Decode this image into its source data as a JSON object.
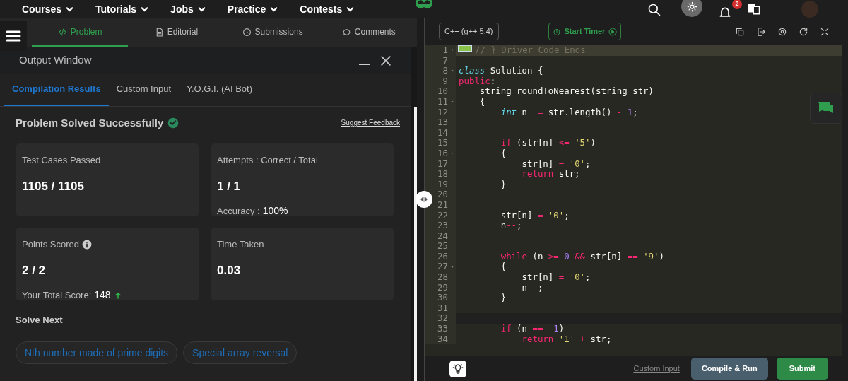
{
  "top_nav": {
    "items": [
      "Courses",
      "Tutorials",
      "Jobs",
      "Practice",
      "Contests"
    ],
    "notification_count": "2"
  },
  "problem_tabs": [
    {
      "label": "Problem",
      "selected": true
    },
    {
      "label": "Editorial",
      "selected": false
    },
    {
      "label": "Submissions",
      "selected": false
    },
    {
      "label": "Comments",
      "selected": false
    }
  ],
  "output_window": {
    "title": "Output Window",
    "tabs": [
      {
        "label": "Compilation Results",
        "selected": true
      },
      {
        "label": "Custom Input",
        "selected": false
      },
      {
        "label": "Y.O.G.I. (AI Bot)",
        "selected": false
      }
    ],
    "status": "Problem Solved Successfully",
    "feedback_link": "Suggest Feedback",
    "stats": [
      {
        "label": "Test Cases Passed",
        "value": "1105 / 1105",
        "info": false
      },
      {
        "label": "Attempts : Correct / Total",
        "value": "1 / 1",
        "info": false,
        "sub_label": "Accuracy :",
        "sub_value": "100%",
        "rising": false
      },
      {
        "label": "Points Scored",
        "value": "2 / 2",
        "info": true,
        "sub_label": "Your Total Score:",
        "sub_value": "148",
        "rising": true
      },
      {
        "label": "Time Taken",
        "value": "0.03",
        "info": false
      }
    ],
    "solve_next_title": "Solve Next",
    "solve_next": [
      "Nth number made of prime digits",
      "Special array reversal"
    ]
  },
  "editor": {
    "language": "C++ (g++ 5.4)",
    "timer_button": "Start Timer",
    "lines": [
      {
        "n": "1",
        "fold": true,
        "folded": true,
        "active": false,
        "tokens": [
          {
            "kind": "comment",
            "text": "// } Driver Code Ends"
          }
        ]
      },
      {
        "n": "7",
        "fold": false,
        "folded": false,
        "active": false
      },
      {
        "n": "8",
        "fold": true,
        "folded": false,
        "active": false,
        "tokens": [
          {
            "kind": "type",
            "text": "class"
          },
          {
            "kind": "plain",
            "text": " Solution {"
          }
        ]
      },
      {
        "n": "9",
        "fold": false,
        "folded": false,
        "active": false,
        "tokens": [
          {
            "kind": "keyword",
            "text": "public"
          },
          {
            "kind": "plain",
            "text": ":"
          }
        ]
      },
      {
        "n": "10",
        "fold": false,
        "folded": false,
        "active": false,
        "tokens": [
          {
            "kind": "plain",
            "text": "    string roundToNearest(string str)"
          }
        ]
      },
      {
        "n": "11",
        "fold": true,
        "folded": false,
        "active": false,
        "tokens": [
          {
            "kind": "plain",
            "text": "    {"
          }
        ]
      },
      {
        "n": "12",
        "fold": false,
        "folded": false,
        "active": false,
        "tokens": [
          {
            "kind": "type",
            "text": "        int"
          },
          {
            "kind": "plain",
            "text": " n  "
          },
          {
            "kind": "keyword",
            "text": "="
          },
          {
            "kind": "plain",
            "text": " str.length() "
          },
          {
            "kind": "keyword",
            "text": "-"
          },
          {
            "kind": "number",
            "text": " 1"
          },
          {
            "kind": "plain",
            "text": ";"
          }
        ]
      },
      {
        "n": "13",
        "fold": false,
        "folded": false,
        "active": false
      },
      {
        "n": "14",
        "fold": false,
        "folded": false,
        "active": false
      },
      {
        "n": "15",
        "fold": false,
        "folded": false,
        "active": false,
        "tokens": [
          {
            "kind": "keyword",
            "text": "        if"
          },
          {
            "kind": "plain",
            "text": " (str[n] "
          },
          {
            "kind": "keyword",
            "text": "<="
          },
          {
            "kind": "string",
            "text": " '5'"
          },
          {
            "kind": "plain",
            "text": ")"
          }
        ]
      },
      {
        "n": "16",
        "fold": true,
        "folded": false,
        "active": false,
        "tokens": [
          {
            "kind": "plain",
            "text": "        {"
          }
        ]
      },
      {
        "n": "17",
        "fold": false,
        "folded": false,
        "active": false,
        "tokens": [
          {
            "kind": "plain",
            "text": "            str[n] "
          },
          {
            "kind": "keyword",
            "text": "="
          },
          {
            "kind": "string",
            "text": " '0'"
          },
          {
            "kind": "plain",
            "text": ";"
          }
        ]
      },
      {
        "n": "18",
        "fold": false,
        "folded": false,
        "active": false,
        "tokens": [
          {
            "kind": "keyword",
            "text": "            return"
          },
          {
            "kind": "plain",
            "text": " str;"
          }
        ]
      },
      {
        "n": "19",
        "fold": false,
        "folded": false,
        "active": false,
        "tokens": [
          {
            "kind": "plain",
            "text": "        }"
          }
        ]
      },
      {
        "n": "20",
        "fold": false,
        "folded": false,
        "active": false
      },
      {
        "n": "21",
        "fold": false,
        "folded": false,
        "active": false
      },
      {
        "n": "22",
        "fold": false,
        "folded": false,
        "active": false,
        "tokens": [
          {
            "kind": "plain",
            "text": "        str[n] "
          },
          {
            "kind": "keyword",
            "text": "="
          },
          {
            "kind": "string",
            "text": " '0'"
          },
          {
            "kind": "plain",
            "text": ";"
          }
        ]
      },
      {
        "n": "23",
        "fold": false,
        "folded": false,
        "active": false,
        "tokens": [
          {
            "kind": "plain",
            "text": "        n"
          },
          {
            "kind": "keyword",
            "text": "--"
          },
          {
            "kind": "plain",
            "text": ";"
          }
        ]
      },
      {
        "n": "24",
        "fold": false,
        "folded": false,
        "active": false
      },
      {
        "n": "25",
        "fold": false,
        "folded": false,
        "active": false
      },
      {
        "n": "26",
        "fold": false,
        "folded": false,
        "active": false,
        "tokens": [
          {
            "kind": "keyword",
            "text": "        while"
          },
          {
            "kind": "plain",
            "text": " (n "
          },
          {
            "kind": "keyword",
            "text": ">="
          },
          {
            "kind": "number",
            "text": " 0"
          },
          {
            "kind": "keyword",
            "text": " &&"
          },
          {
            "kind": "plain",
            "text": " str[n] "
          },
          {
            "kind": "keyword",
            "text": "=="
          },
          {
            "kind": "string",
            "text": " '9'"
          },
          {
            "kind": "plain",
            "text": ")"
          }
        ]
      },
      {
        "n": "27",
        "fold": true,
        "folded": false,
        "active": false,
        "tokens": [
          {
            "kind": "plain",
            "text": "        {"
          }
        ]
      },
      {
        "n": "28",
        "fold": false,
        "folded": false,
        "active": false,
        "tokens": [
          {
            "kind": "plain",
            "text": "            str[n] "
          },
          {
            "kind": "keyword",
            "text": "="
          },
          {
            "kind": "string",
            "text": " '0'"
          },
          {
            "kind": "plain",
            "text": ";"
          }
        ]
      },
      {
        "n": "29",
        "fold": false,
        "folded": false,
        "active": false,
        "tokens": [
          {
            "kind": "plain",
            "text": "            n"
          },
          {
            "kind": "keyword",
            "text": "--"
          },
          {
            "kind": "plain",
            "text": ";"
          }
        ]
      },
      {
        "n": "30",
        "fold": false,
        "folded": false,
        "active": false,
        "tokens": [
          {
            "kind": "plain",
            "text": "        }"
          }
        ]
      },
      {
        "n": "31",
        "fold": false,
        "folded": false,
        "active": false
      },
      {
        "n": "32",
        "fold": false,
        "folded": false,
        "active": true
      },
      {
        "n": "33",
        "fold": false,
        "folded": false,
        "active": false,
        "tokens": [
          {
            "kind": "keyword",
            "text": "        if"
          },
          {
            "kind": "plain",
            "text": " (n "
          },
          {
            "kind": "keyword",
            "text": "=="
          },
          {
            "kind": "number",
            "text": " -1"
          },
          {
            "kind": "plain",
            "text": ")"
          }
        ]
      },
      {
        "n": "34",
        "fold": false,
        "folded": false,
        "active": false,
        "tokens": [
          {
            "kind": "keyword",
            "text": "            return"
          },
          {
            "kind": "string",
            "text": " '1'"
          },
          {
            "kind": "keyword",
            "text": " +"
          },
          {
            "kind": "plain",
            "text": " str;"
          }
        ]
      }
    ],
    "footer": {
      "custom_input_link": "Custom Input",
      "run_button": "Compile & Run",
      "submit_button": "Submit"
    }
  }
}
